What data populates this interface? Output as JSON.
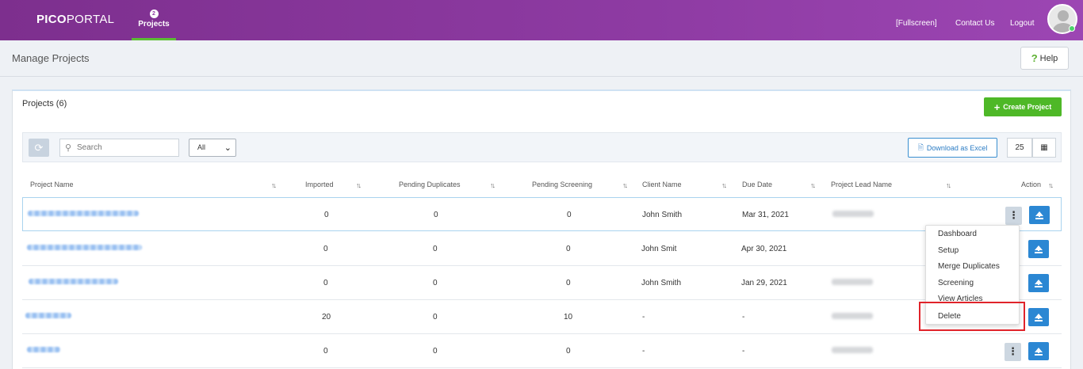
{
  "nav": {
    "logo_bold": "PICO",
    "logo_light": "PORTAL",
    "tab_projects": "Projects",
    "tab_badge": "2",
    "fullscreen": "[Fullscreen]",
    "contact": "Contact Us",
    "logout": "Logout"
  },
  "header": {
    "title": "Manage Projects",
    "help": "Help"
  },
  "panel": {
    "title": "Projects (6)",
    "create": "Create Project"
  },
  "toolbar": {
    "search_placeholder": "Search",
    "filter_value": "All",
    "download": "Download as Excel",
    "page_size": "25"
  },
  "table": {
    "columns": [
      "Project Name",
      "Imported",
      "Pending Duplicates",
      "Pending Screening",
      "Client Name",
      "Due Date",
      "Project Lead Name",
      "Action"
    ],
    "rows": [
      {
        "imported": "0",
        "pending_duplicates": "0",
        "pending_screening": "0",
        "client": "John Smith",
        "due": "Mar 31, 2021"
      },
      {
        "imported": "0",
        "pending_duplicates": "0",
        "pending_screening": "0",
        "client": "John Smit",
        "due": "Apr 30, 2021"
      },
      {
        "imported": "0",
        "pending_duplicates": "0",
        "pending_screening": "0",
        "client": "John Smith",
        "due": "Jan 29, 2021"
      },
      {
        "imported": "20",
        "pending_duplicates": "0",
        "pending_screening": "10",
        "client": "-",
        "due": "-"
      },
      {
        "imported": "0",
        "pending_duplicates": "0",
        "pending_screening": "0",
        "client": "-",
        "due": "-"
      }
    ]
  },
  "action_menu": {
    "items": [
      "Dashboard",
      "Setup",
      "Merge Duplicates",
      "Screening",
      "View Articles",
      "Delete"
    ]
  },
  "colors": {
    "nav_bg": "#8e3ba3",
    "create_btn": "#4eb827",
    "upload_btn": "#2b87d3",
    "highlight": "#e0232a"
  }
}
